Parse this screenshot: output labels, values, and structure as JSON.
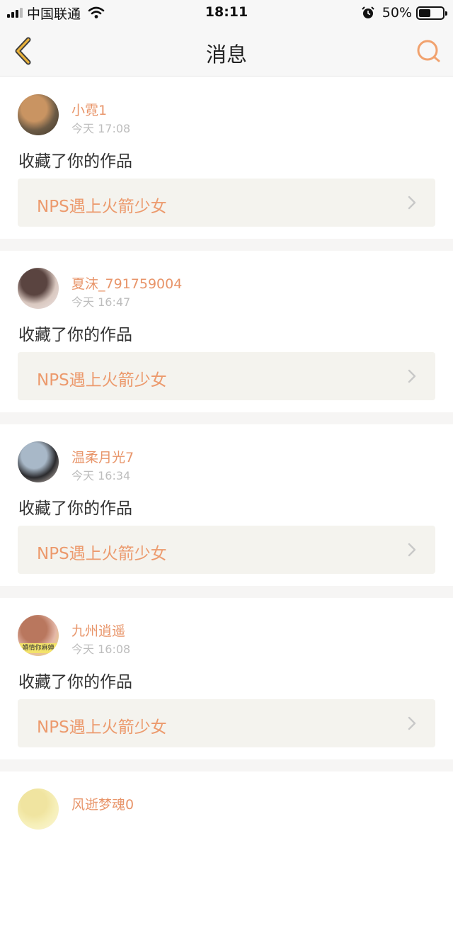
{
  "status": {
    "carrier": "中国联通",
    "time": "18:11",
    "battery": "50%",
    "battery_level": 0.5
  },
  "nav": {
    "title": "消息",
    "back_icon": "back-chevron-icon",
    "search_icon": "search-icon",
    "accent": "#e8b13a"
  },
  "messages": [
    {
      "name": "小霓1",
      "time": "今天 17:08",
      "action": "收藏了你的作品",
      "work": "NPS遇上火箭少女",
      "avatar_colors": [
        "#6b5a45",
        "#c99462",
        "#3f3527"
      ]
    },
    {
      "name": "夏沫_791759004",
      "time": "今天 16:47",
      "action": "收藏了你的作品",
      "work": "NPS遇上火箭少女",
      "avatar_colors": [
        "#d9c8c0",
        "#5a4440",
        "#f0e6e6"
      ]
    },
    {
      "name": "温柔月光7",
      "time": "今天 16:34",
      "action": "收藏了你的作品",
      "work": "NPS遇上火箭少女",
      "avatar_colors": [
        "#2b2b2e",
        "#a8b8c8",
        "#e7d9cf"
      ]
    },
    {
      "name": "九州逍遥",
      "time": "今天 16:08",
      "action": "收藏了你的作品",
      "work": "NPS遇上火箭少女",
      "avatar_colors": [
        "#e4b8a9",
        "#b9775e",
        "#f3e36a"
      ],
      "avatar_caption": "婚情你麻婵"
    },
    {
      "name": "风逝梦魂0",
      "time": "",
      "action": "",
      "work": "",
      "avatar_colors": [
        "#f6efb8",
        "#f0e4a0",
        "#fbf6d8"
      ]
    }
  ]
}
